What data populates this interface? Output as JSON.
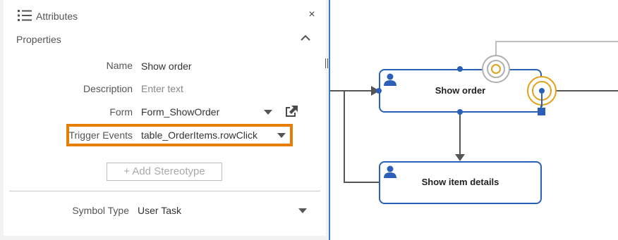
{
  "panel": {
    "title": "Attributes",
    "close_symbol": "×",
    "section_title": "Properties"
  },
  "properties": {
    "name": {
      "label": "Name",
      "value": "Show order"
    },
    "description": {
      "label": "Description",
      "placeholder": "Enter text"
    },
    "form": {
      "label": "Form",
      "value": "Form_ShowOrder"
    },
    "trigger_events": {
      "label": "Trigger Events",
      "value": "table_OrderItems.rowClick"
    },
    "add_stereotype": "+ Add Stereotype",
    "symbol_type": {
      "label": "Symbol Type",
      "value": "User Task"
    }
  },
  "diagram": {
    "tasks": [
      {
        "id": "show-order",
        "label": "Show order"
      },
      {
        "id": "show-item-details",
        "label": "Show item details"
      }
    ]
  },
  "colors": {
    "highlight": "#e67e00",
    "task_border": "#2b5fb8",
    "event_ring": "#e0a21a",
    "splitter": "#3a7fc4"
  },
  "icons": [
    "list-icon",
    "close-icon",
    "chevron-up-icon",
    "dropdown-arrow-icon",
    "external-link-icon",
    "user-icon",
    "boundary-event-icon"
  ]
}
